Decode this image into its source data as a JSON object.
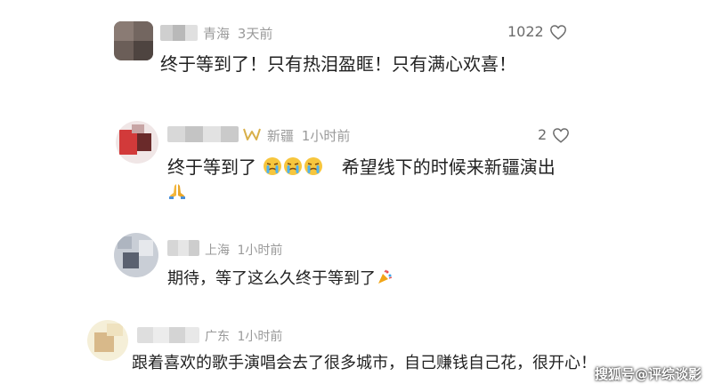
{
  "comments": [
    {
      "region": "青海",
      "time": "3天前",
      "likes": "1022",
      "text": "终于等到了！只有热泪盈眶！只有满心欢喜！"
    },
    {
      "region": "新疆",
      "time": "1小时前",
      "likes": "2",
      "text": "终于等到了",
      "text2": "希望线下的时候来新疆演出"
    },
    {
      "region": "上海",
      "time": "1小时前",
      "text": "期待，等了这么久终于等到了"
    },
    {
      "region": "广东",
      "time": "1小时前",
      "text": "跟着喜欢的歌手演唱会去了很多城市，自己赚钱自己花，很开心！"
    }
  ],
  "watermark": "搜狐号@评综谈影",
  "icons": {
    "like": "heart-outline-icon",
    "crying": "crying-emoji-icon",
    "pray": "praying-hands-emoji-icon",
    "party": "party-popper-emoji-icon",
    "badge": "vip-badge-icon"
  }
}
